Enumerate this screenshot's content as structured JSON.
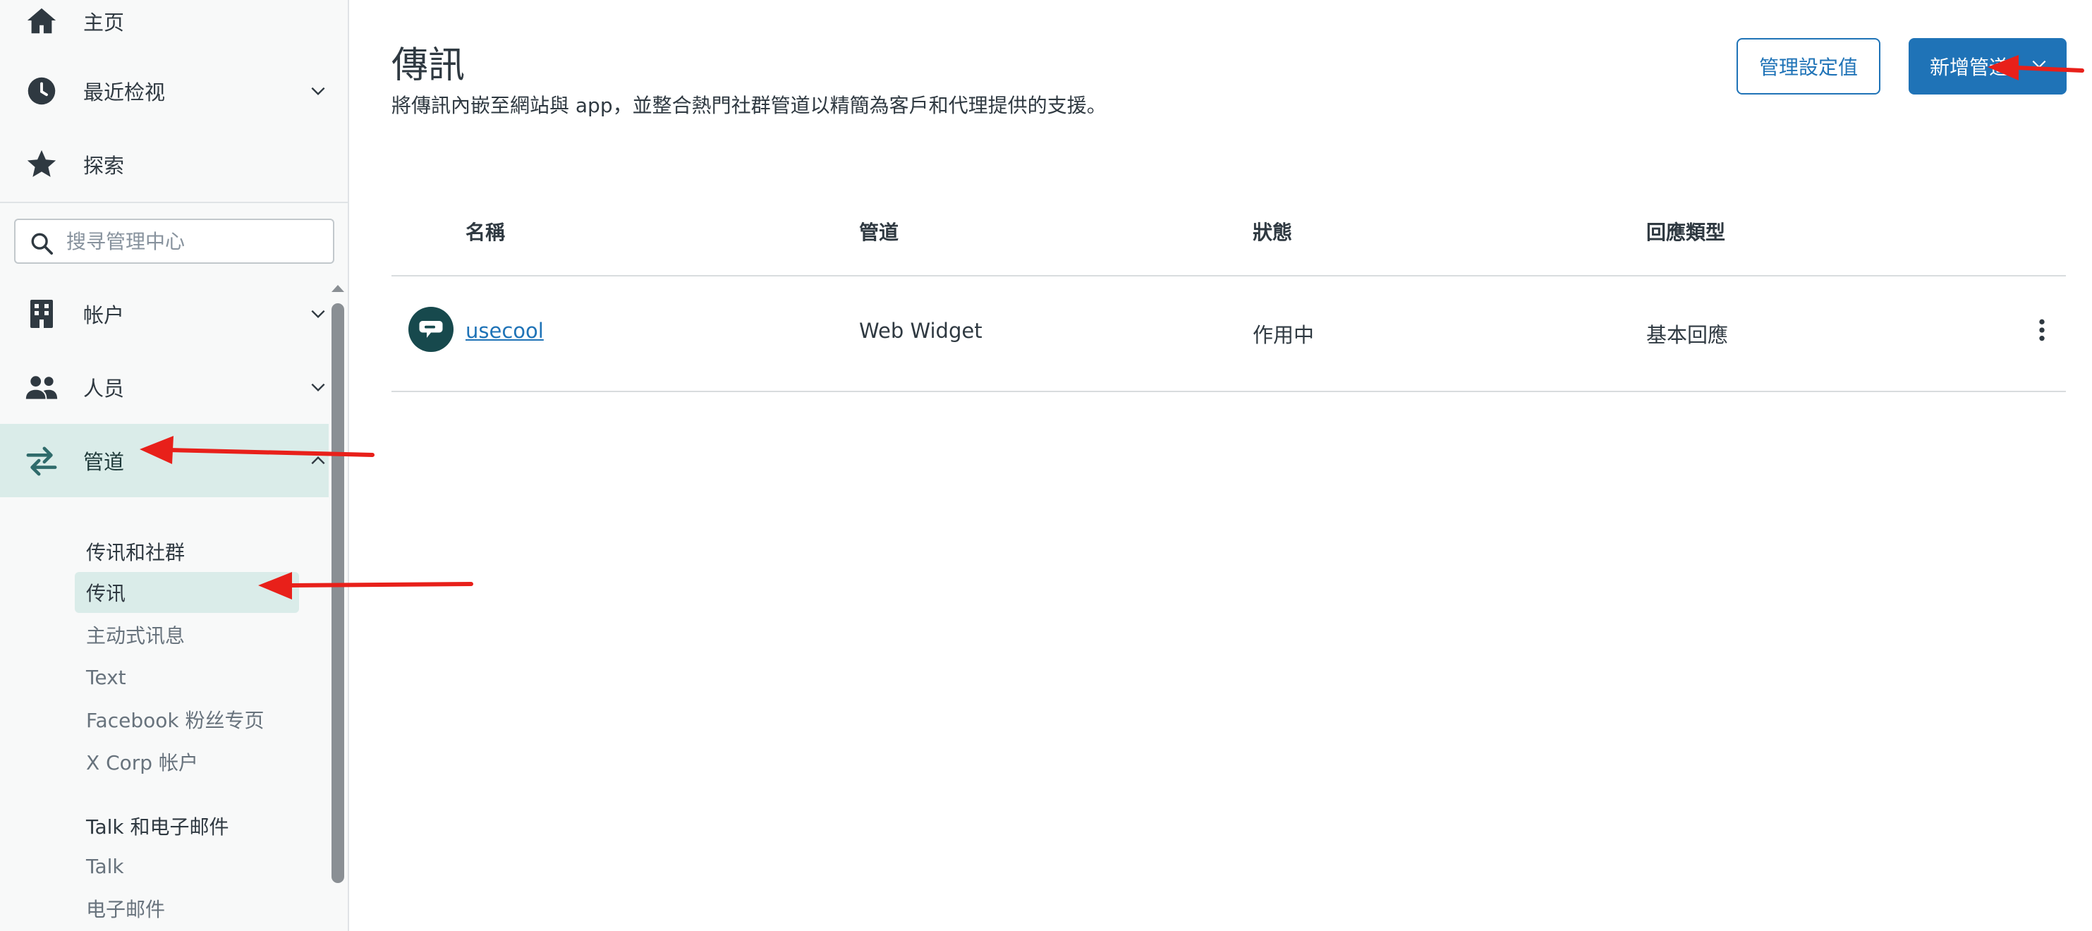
{
  "sidebar": {
    "home": {
      "label": "主页",
      "icon": "home-icon"
    },
    "recent": {
      "label": "最近检视",
      "icon": "clock-icon"
    },
    "explore": {
      "label": "探索",
      "icon": "star-icon"
    },
    "search": {
      "placeholder": "搜寻管理中心"
    },
    "account": {
      "label": "帐户",
      "icon": "building-icon"
    },
    "people": {
      "label": "人员",
      "icon": "people-icon"
    },
    "channels": {
      "label": "管道",
      "icon": "arrows-swap-icon"
    },
    "messaging_group": {
      "heading": "传讯和社群",
      "items": [
        "传讯",
        "主动式讯息",
        "Text",
        "Facebook 粉丝专页",
        "X Corp 帐户"
      ]
    },
    "talk_group": {
      "heading": "Talk 和电子邮件",
      "items": [
        "Talk",
        "电子邮件"
      ]
    }
  },
  "header": {
    "title": "傳訊",
    "description": "將傳訊內嵌至網站與 app，並整合熱門社群管道以精簡為客戶和代理提供的支援。",
    "manage_settings_label": "管理設定值",
    "add_channel_label": "新增管道"
  },
  "table": {
    "columns": [
      "名稱",
      "管道",
      "狀態",
      "回應類型"
    ],
    "rows": [
      {
        "name": "usecool",
        "channel": "Web Widget",
        "status": "作用中",
        "response_type": "基本回應"
      }
    ]
  },
  "colors": {
    "accent": "#1f73b7",
    "active_bg": "#daece9",
    "avatar_bg": "#17494d",
    "annotation": "#e8201a"
  }
}
